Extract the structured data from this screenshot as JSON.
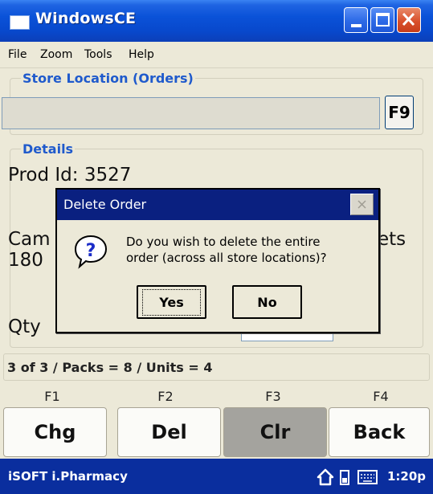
{
  "window": {
    "title": "WindowsCE"
  },
  "menu": {
    "items": [
      "File",
      "Zoom",
      "Tools",
      "Help"
    ]
  },
  "store": {
    "group_label": "Store Location (Orders)",
    "value": "",
    "f9_label": "F9"
  },
  "details": {
    "group_label": "Details",
    "prod_id": "Prod Id: 3527",
    "line2_start": "Cam",
    "line2_end": "ets",
    "line3": "180",
    "qty_label": "Qty"
  },
  "status": {
    "text": "3 of 3 / Packs = 8 / Units = 4"
  },
  "fkeys": [
    {
      "key": "F1",
      "label": "Chg"
    },
    {
      "key": "F2",
      "label": "Del"
    },
    {
      "key": "F3",
      "label": "Clr"
    },
    {
      "key": "F4",
      "label": "Back"
    }
  ],
  "taskbar": {
    "app": "iSOFT i.Pharmacy",
    "time": "1:20p"
  },
  "dialog": {
    "title": "Delete Order",
    "message_line1": "Do you wish to delete the entire",
    "message_line2": "order (across all store locations)?",
    "yes_label": "Yes",
    "no_label": "No"
  },
  "colors": {
    "titlebar": "#0a52d8",
    "dialog_title": "#0a2080",
    "taskbar": "#0a2e9e",
    "group_label": "#1f5acc",
    "pressed_button": "#a4a39e"
  }
}
